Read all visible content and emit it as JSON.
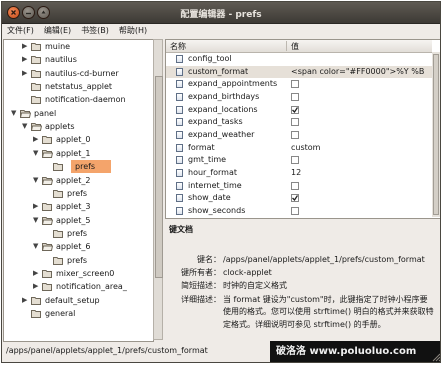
{
  "window": {
    "title": "配置编辑器 - prefs"
  },
  "menu": [
    {
      "label": "文件(F)"
    },
    {
      "label": "编辑(E)"
    },
    {
      "label": "书签(B)"
    },
    {
      "label": "帮助(H)"
    }
  ],
  "tree": [
    {
      "label": "muine",
      "depth": 2,
      "expanded": false,
      "arrow": true,
      "selected": false
    },
    {
      "label": "nautilus",
      "depth": 2,
      "expanded": false,
      "arrow": true,
      "selected": false
    },
    {
      "label": "nautilus-cd-burner",
      "depth": 2,
      "expanded": false,
      "arrow": true,
      "selected": false
    },
    {
      "label": "netstatus_applet",
      "depth": 2,
      "expanded": false,
      "arrow": false,
      "selected": false
    },
    {
      "label": "notification-daemon",
      "depth": 2,
      "expanded": false,
      "arrow": false,
      "selected": false
    },
    {
      "label": "panel",
      "depth": 1,
      "expanded": true,
      "arrow": true,
      "selected": false
    },
    {
      "label": "applets",
      "depth": 2,
      "expanded": true,
      "arrow": true,
      "selected": false
    },
    {
      "label": "applet_0",
      "depth": 3,
      "expanded": false,
      "arrow": true,
      "selected": false
    },
    {
      "label": "applet_1",
      "depth": 3,
      "expanded": true,
      "arrow": true,
      "selected": false
    },
    {
      "label": "prefs",
      "depth": 4,
      "expanded": false,
      "arrow": false,
      "selected": true
    },
    {
      "label": "applet_2",
      "depth": 3,
      "expanded": true,
      "arrow": true,
      "selected": false
    },
    {
      "label": "prefs",
      "depth": 4,
      "expanded": false,
      "arrow": false,
      "selected": false
    },
    {
      "label": "applet_3",
      "depth": 3,
      "expanded": false,
      "arrow": true,
      "selected": false
    },
    {
      "label": "applet_5",
      "depth": 3,
      "expanded": true,
      "arrow": true,
      "selected": false
    },
    {
      "label": "prefs",
      "depth": 4,
      "expanded": false,
      "arrow": false,
      "selected": false
    },
    {
      "label": "applet_6",
      "depth": 3,
      "expanded": true,
      "arrow": true,
      "selected": false
    },
    {
      "label": "prefs",
      "depth": 4,
      "expanded": false,
      "arrow": false,
      "selected": false
    },
    {
      "label": "mixer_screen0",
      "depth": 3,
      "expanded": false,
      "arrow": true,
      "selected": false
    },
    {
      "label": "notification_area_",
      "depth": 3,
      "expanded": false,
      "arrow": true,
      "selected": false
    },
    {
      "label": "default_setup",
      "depth": 2,
      "expanded": false,
      "arrow": true,
      "selected": false
    },
    {
      "label": "general",
      "depth": 2,
      "expanded": false,
      "arrow": false,
      "selected": false
    }
  ],
  "list_header": {
    "name": "名称",
    "value": "值"
  },
  "keys": [
    {
      "name": "config_tool",
      "type": "text",
      "value": "",
      "checked": false,
      "selected": false
    },
    {
      "name": "custom_format",
      "type": "text",
      "value": "<span color=\"#FF0000\">%Y %B",
      "checked": false,
      "selected": true
    },
    {
      "name": "expand_appointments",
      "type": "bool",
      "value": "",
      "checked": false,
      "selected": false
    },
    {
      "name": "expand_birthdays",
      "type": "bool",
      "value": "",
      "checked": false,
      "selected": false
    },
    {
      "name": "expand_locations",
      "type": "bool",
      "value": "",
      "checked": true,
      "selected": false
    },
    {
      "name": "expand_tasks",
      "type": "bool",
      "value": "",
      "checked": false,
      "selected": false
    },
    {
      "name": "expand_weather",
      "type": "bool",
      "value": "",
      "checked": false,
      "selected": false
    },
    {
      "name": "format",
      "type": "text",
      "value": "custom",
      "checked": false,
      "selected": false
    },
    {
      "name": "gmt_time",
      "type": "bool",
      "value": "",
      "checked": false,
      "selected": false
    },
    {
      "name": "hour_format",
      "type": "text",
      "value": "12",
      "checked": false,
      "selected": false
    },
    {
      "name": "internet_time",
      "type": "bool",
      "value": "",
      "checked": false,
      "selected": false
    },
    {
      "name": "show_date",
      "type": "bool",
      "value": "",
      "checked": true,
      "selected": false
    },
    {
      "name": "show_seconds",
      "type": "bool",
      "value": "",
      "checked": false,
      "selected": false
    }
  ],
  "doc": {
    "heading": "键文档",
    "rows": [
      {
        "key": "键名：",
        "value": "/apps/panel/applets/applet_1/prefs/custom_format"
      },
      {
        "key": "键所有者：",
        "value": "clock-applet"
      },
      {
        "key": "简短描述：",
        "value": "时钟的自定义格式"
      },
      {
        "key": "详细描述：",
        "value": "当 format 键设为\"custom\"时，此键指定了时钟小程序要"
      },
      {
        "key": "",
        "value": "使用的格式。您可以使用 strftime() 明白的格式并来获取特"
      },
      {
        "key": "",
        "value": "定格式。详细说明可参见 strftime() 的手册。"
      }
    ]
  },
  "status": {
    "path": "/apps/panel/applets/applet_1/prefs/custom_format"
  },
  "watermark": "破洛洛 www.poluoluo.com",
  "colors": {
    "selection": "#f4a46b",
    "titlebar": "#3d3a35",
    "window_bg": "#efebe7"
  }
}
